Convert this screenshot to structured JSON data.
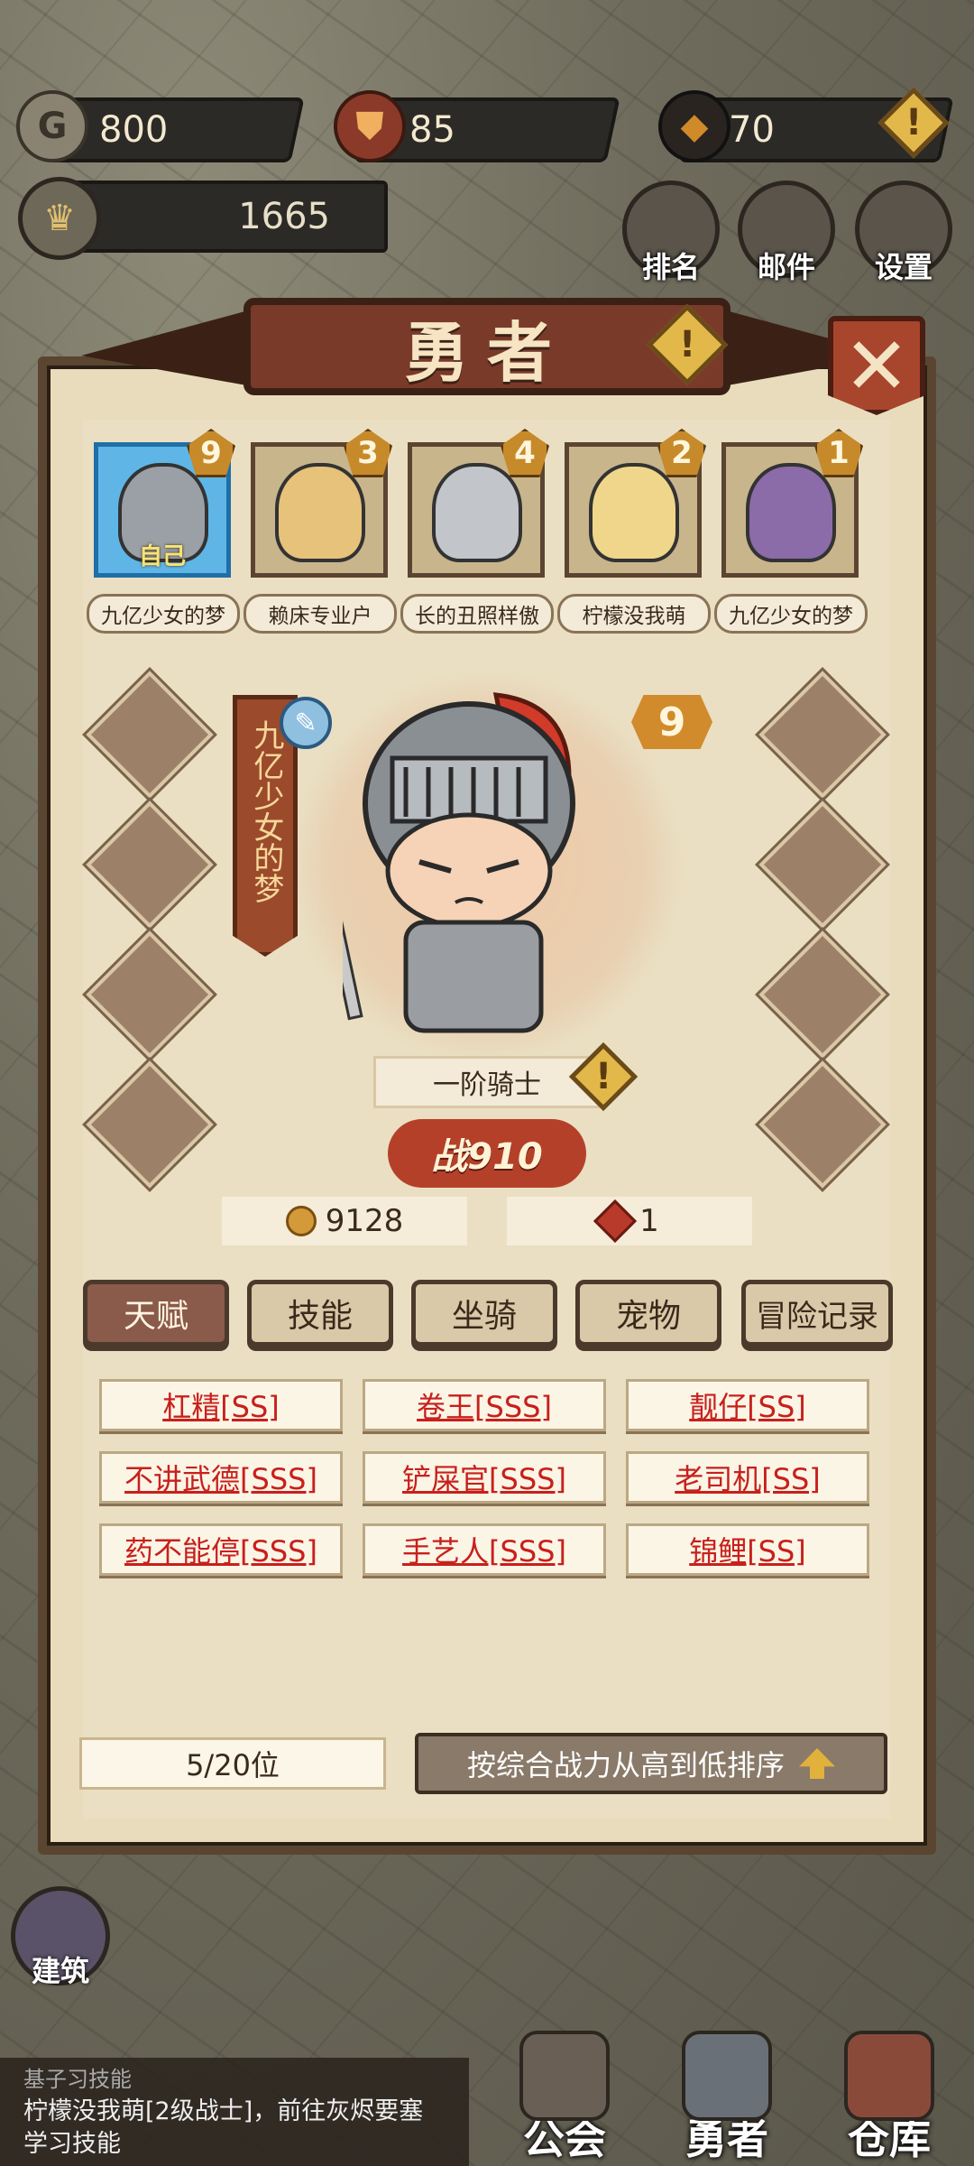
{
  "resources": {
    "gold": "800",
    "shield": "85",
    "stone": "70",
    "power": "1665"
  },
  "top_buttons": {
    "rank": "排名",
    "mail": "邮件",
    "settings": "设置"
  },
  "dialog": {
    "title": "勇者"
  },
  "heroes": [
    {
      "name": "九亿少女的梦",
      "level": "9",
      "tag": "自己",
      "selected": true
    },
    {
      "name": "赖床专业户",
      "level": "3"
    },
    {
      "name": "长的丑照样傲",
      "level": "4"
    },
    {
      "name": "柠檬没我萌",
      "level": "2"
    },
    {
      "name": "九亿少女的梦",
      "level": "1"
    }
  ],
  "selected_hero": {
    "banner_name": "九亿少女的梦",
    "level": "9",
    "class": "一阶骑士",
    "power": "战910",
    "gold": "9128",
    "gems": "1"
  },
  "tabs": [
    "天赋",
    "技能",
    "坐骑",
    "宠物",
    "冒险记录"
  ],
  "talents": [
    "杠精[SS]",
    "卷王[SSS]",
    "靓仔[SS]",
    "不讲武德[SSS]",
    "铲屎官[SSS]",
    "老司机[SS]",
    "药不能停[SSS]",
    "手艺人[SSS]",
    "锦鲤[SS]"
  ],
  "pager": "5/20位",
  "sort_label": "按综合战力从高到低排序",
  "build_label": "建筑",
  "chat": {
    "line1": "基子习技能",
    "line2": "柠檬没我萌[2级战士]，前往灰烬要塞",
    "line3": "学习技能"
  },
  "nav": {
    "guild": "公会",
    "hero": "勇者",
    "warehouse": "仓库"
  }
}
